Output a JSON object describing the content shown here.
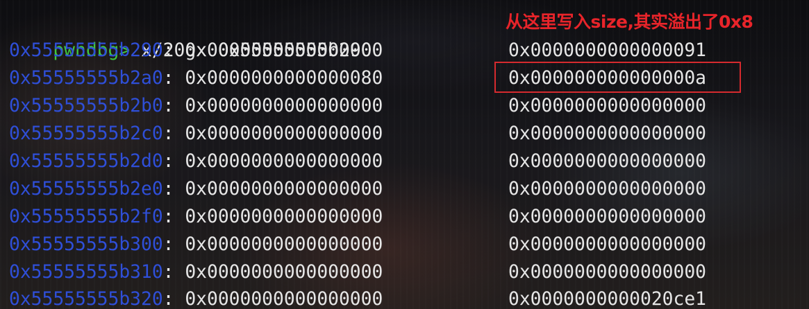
{
  "command_line": {
    "prompt": "pwndbg> ",
    "command": "x/20gx 0x55555555b290"
  },
  "annotation": {
    "text": "从这里写入size,其实溢出了0x8",
    "color": "#e8242a"
  },
  "memory_rows": [
    {
      "address": "0x55555555b290",
      "word1": "0x0000000000000000",
      "word2": "0x0000000000000091"
    },
    {
      "address": "0x55555555b2a0",
      "word1": "0x0000000000000080",
      "word2": "0x000000000000000a"
    },
    {
      "address": "0x55555555b2b0",
      "word1": "0x0000000000000000",
      "word2": "0x0000000000000000"
    },
    {
      "address": "0x55555555b2c0",
      "word1": "0x0000000000000000",
      "word2": "0x0000000000000000"
    },
    {
      "address": "0x55555555b2d0",
      "word1": "0x0000000000000000",
      "word2": "0x0000000000000000"
    },
    {
      "address": "0x55555555b2e0",
      "word1": "0x0000000000000000",
      "word2": "0x0000000000000000"
    },
    {
      "address": "0x55555555b2f0",
      "word1": "0x0000000000000000",
      "word2": "0x0000000000000000"
    },
    {
      "address": "0x55555555b300",
      "word1": "0x0000000000000000",
      "word2": "0x0000000000000000"
    },
    {
      "address": "0x55555555b310",
      "word1": "0x0000000000000000",
      "word2": "0x0000000000000000"
    },
    {
      "address": "0x55555555b320",
      "word1": "0x0000000000000000",
      "word2": "0x0000000000020ce1"
    }
  ],
  "colors": {
    "prompt": "#3fc63f",
    "address": "#2f4fd8",
    "text": "#e6e6e6",
    "highlight_border": "#d62a2e"
  }
}
